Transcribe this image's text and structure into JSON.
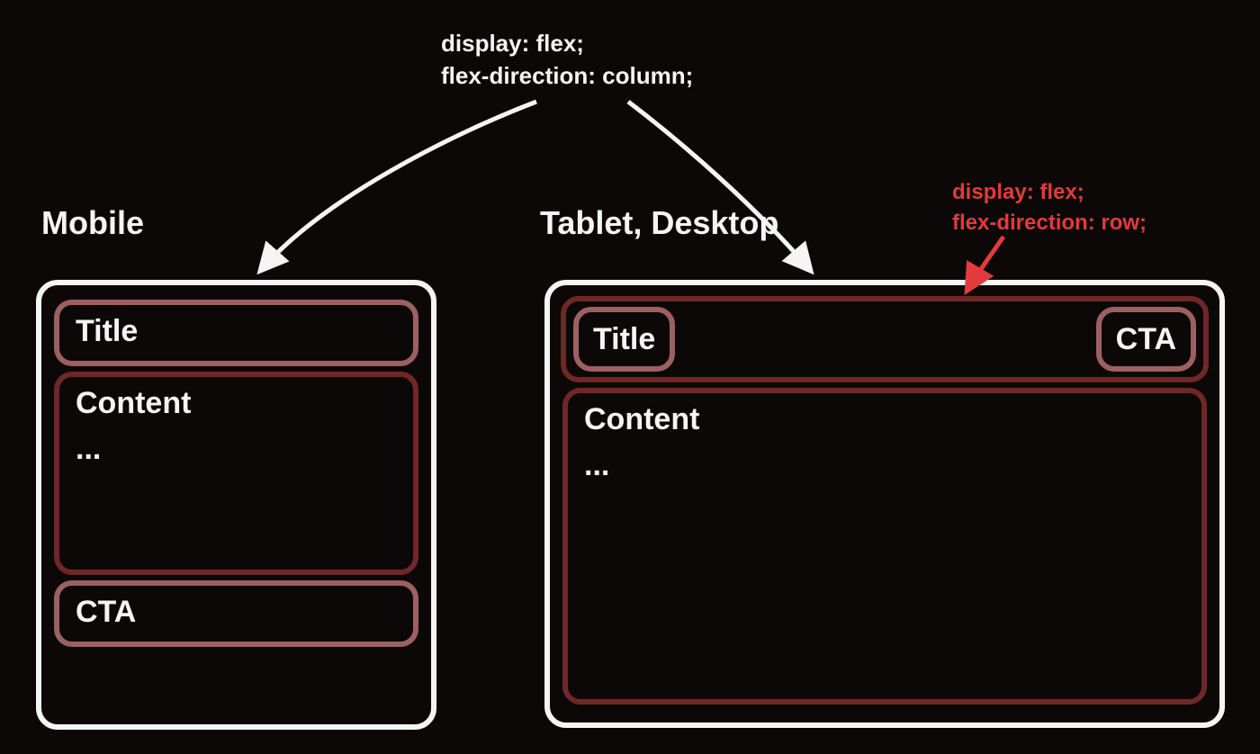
{
  "annotations": {
    "column": "display: flex;\nflex-direction: column;",
    "row": "display: flex;\nflex-direction: row;"
  },
  "headings": {
    "mobile": "Mobile",
    "desktop": "Tablet, Desktop"
  },
  "labels": {
    "title": "Title",
    "content": "Content",
    "ellipsis": "...",
    "cta": "CTA"
  },
  "colors": {
    "background": "#0c0808",
    "text": "#f5f5f5",
    "border_light": "#9d6060",
    "border_dark": "#6f2727",
    "accent_red": "#e13b3b"
  }
}
